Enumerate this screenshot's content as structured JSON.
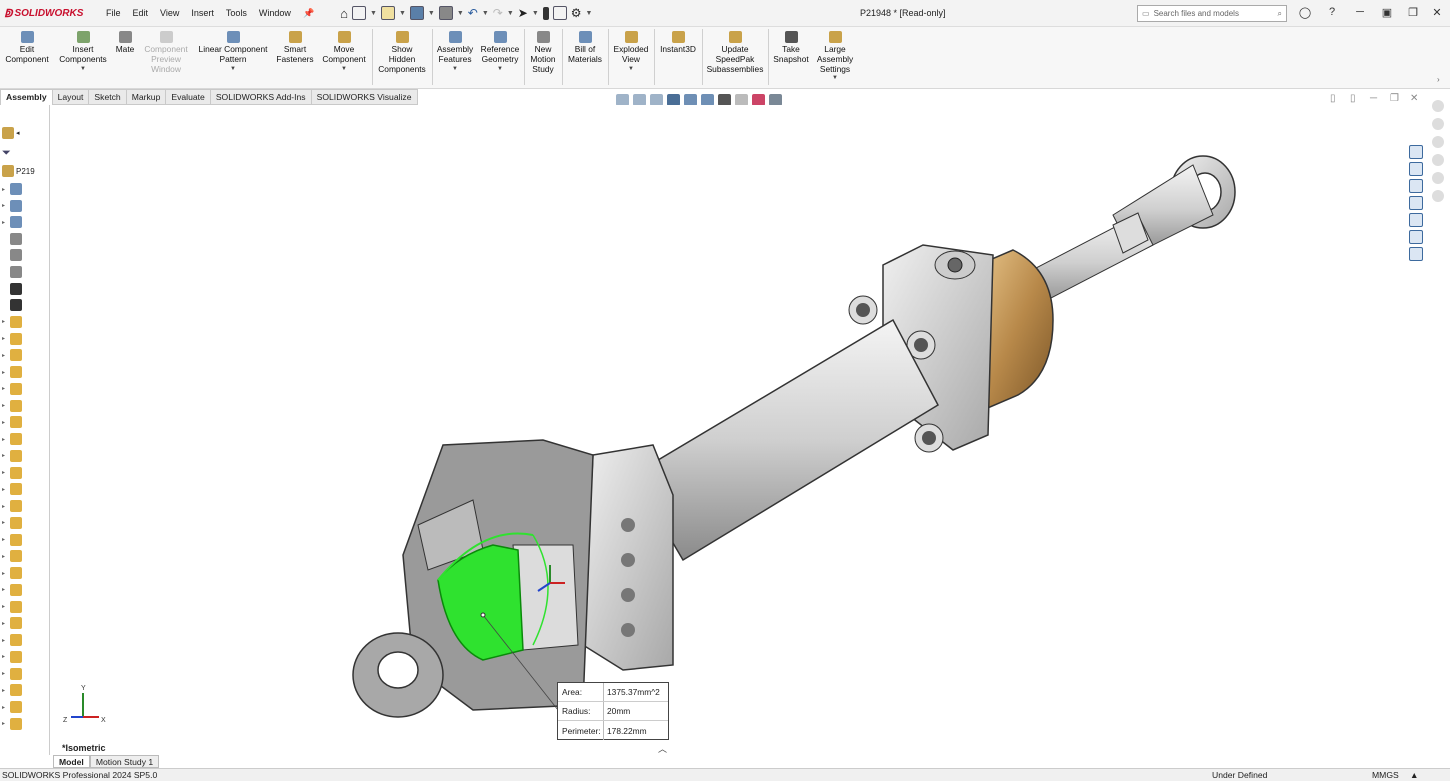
{
  "app": {
    "brand": "SOLIDWORKS",
    "doc_title": "P21948 * [Read-only]"
  },
  "menu": [
    "File",
    "Edit",
    "View",
    "Insert",
    "Tools",
    "Window"
  ],
  "search": {
    "placeholder": "Search files and models"
  },
  "commands": [
    {
      "label": "Edit\nComponent"
    },
    {
      "label": "Insert\nComponents"
    },
    {
      "label": "Mate"
    },
    {
      "label": "Component\nPreview\nWindow",
      "disabled": true
    },
    {
      "label": "Linear Component\nPattern"
    },
    {
      "label": "Smart\nFasteners"
    },
    {
      "label": "Move\nComponent"
    },
    {
      "label": "Show\nHidden\nComponents"
    },
    {
      "label": "Assembly\nFeatures"
    },
    {
      "label": "Reference\nGeometry"
    },
    {
      "label": "New\nMotion\nStudy"
    },
    {
      "label": "Bill of\nMaterials"
    },
    {
      "label": "Exploded\nView"
    },
    {
      "label": "Instant3D"
    },
    {
      "label": "Update\nSpeedPak\nSubassemblies"
    },
    {
      "label": "Take\nSnapshot"
    },
    {
      "label": "Large\nAssembly\nSettings"
    }
  ],
  "tabs": [
    "Assembly",
    "Layout",
    "Sketch",
    "Markup",
    "Evaluate",
    "SOLIDWORKS Add-Ins",
    "SOLIDWORKS Visualize"
  ],
  "tree": {
    "root_label": "P219"
  },
  "measure": {
    "area_label": "Area:",
    "area_value": "1375.37mm^2",
    "radius_label": "Radius:",
    "radius_value": "20mm",
    "perimeter_label": "Perimeter:",
    "perimeter_value": "178.22mm"
  },
  "view_label": "*Isometric",
  "bottom_tabs": [
    "Model",
    "Motion Study 1"
  ],
  "status": {
    "product": "SOLIDWORKS Professional 2024 SP5.0",
    "state": "Under Defined",
    "units": "MMGS"
  },
  "triad": {
    "x": "X",
    "y": "Y",
    "z": "Z"
  },
  "colors": {
    "brand": "#c8102e",
    "selection": "#2fe22f",
    "brass": "#b8894a"
  }
}
